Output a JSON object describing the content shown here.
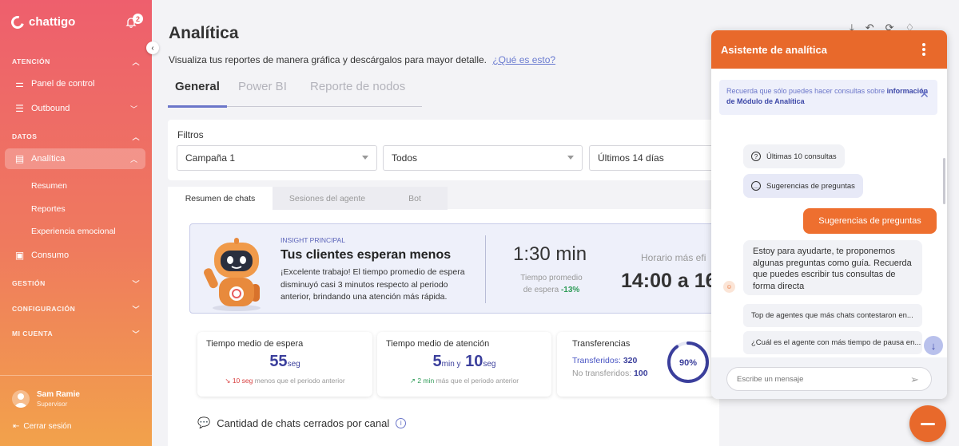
{
  "brand": {
    "name": "chattigo",
    "notification_count": "2"
  },
  "sidebar": {
    "sections": {
      "atencion": "ATENCIÓN",
      "datos": "DATOS",
      "gestion": "GESTIÓN",
      "configuracion": "CONFIGURACIÓN",
      "mi_cuenta": "MI CUENTA"
    },
    "items": {
      "panel": "Panel de control",
      "outbound": "Outbound",
      "analitica": "Analítica",
      "consumo": "Consumo"
    },
    "sub_items": [
      "Resumen",
      "Reportes",
      "Experiencia emocional"
    ],
    "user": {
      "name": "Sam Ramie",
      "role": "Supervisor"
    },
    "logout": "Cerrar sesión"
  },
  "page": {
    "title": "Analítica",
    "subtitle": "Visualiza tus reportes de manera gráfica y descárgalos para mayor detalle.",
    "help_link": "¿Qué es esto?",
    "tabs": [
      "General",
      "Power BI",
      "Reporte de nodos"
    ]
  },
  "filters": {
    "label": "Filtros",
    "campaign": "Campaña 1",
    "scope": "Todos",
    "period": "Últimos 14 días"
  },
  "sub_tabs": [
    "Resumen de chats",
    "Sesiones del agente",
    "Bot"
  ],
  "insight": {
    "tag": "INSIGHT PRINCIPAL",
    "title": "Tus clientes esperan menos",
    "body": "¡Excelente trabajo! El tiempo promedio de espera disminuyó casi 3 minutos respecto al periodo anterior, brindando una atención más rápida.",
    "wait_time": "1:30 min",
    "wait_label": "Tiempo promedio de espera",
    "wait_delta": "-13%",
    "peak_label": "Horario más efi",
    "peak_value": "14:00 a 16"
  },
  "metrics": {
    "wait": {
      "title": "Tiempo medio de espera",
      "value": "55",
      "unit": "seg",
      "delta": "10 seg",
      "note": "menos que el periodo anterior"
    },
    "attention": {
      "title": "Tiempo medio de atención",
      "value_min": "5",
      "unit_min": "min y",
      "value_sec": "10",
      "unit_sec": "seg",
      "delta": "2 min",
      "note": "más que el periodo anterior"
    },
    "transfers": {
      "title": "Transferencias",
      "transferred_label": "Transferidos:",
      "transferred": "320",
      "not_transferred_label": "No transferidos:",
      "not_transferred": "100",
      "percent_label": "90%",
      "percent": 0.9
    }
  },
  "chats_section": "Cantidad de chats cerrados por canal",
  "assistant": {
    "title": "Asistente de analítica",
    "notice_text": "Recuerda que sólo puedes hacer consultas sobre",
    "notice_bold": "información de Módulo de Analítica",
    "chip_recent": "Últimas 10 consultas",
    "chip_suggestions": "Sugerencias de preguntas",
    "user_message": "Sugerencias de preguntas",
    "bot_message": "Estoy para ayudarte, te proponemos algunas preguntas como guía. Recuerda que puedes escribir tus consultas de forma directa",
    "suggestions": [
      "Top de agentes que más chats contestaron en...",
      "¿Cuál es el agente con más tiempo de pausa en..."
    ],
    "input_placeholder": "Escribe un mensaje"
  },
  "colors": {
    "accent": "#e8692b",
    "primary": "#3b3f9c",
    "link": "#6a7bd0"
  }
}
